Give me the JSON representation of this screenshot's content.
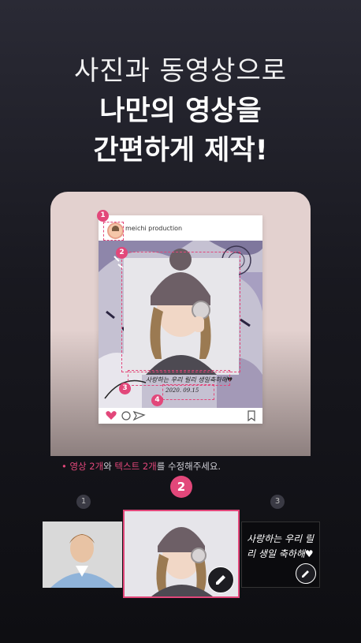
{
  "headline": {
    "line1": "사진과 동영상으로",
    "line2": "나만의 영상을",
    "line3": "간편하게 제작!"
  },
  "preview": {
    "profile_name": "meichi production",
    "caption": "사랑하는 우리 릴리 생일축하해♥",
    "date": "2020. 09.15",
    "markers": [
      "1",
      "2",
      "3",
      "4"
    ]
  },
  "hint": {
    "bullet": "•",
    "video_count": "영상 2개",
    "and": "와",
    "text_count": "텍스트 2개",
    "suffix": "를 수정해주세요."
  },
  "steps": {
    "step1": "1",
    "step2": "2",
    "step3": "3"
  },
  "thumbnails": {
    "text_clip": "사랑하는 우리 릴리 생일 축하해♥"
  },
  "colors": {
    "accent": "#e2477a",
    "panel": "#e3d1cf",
    "background": "#18181f"
  },
  "icons": [
    "pencil-icon",
    "heart-icon",
    "comment-icon",
    "share-icon",
    "bookmark-icon"
  ]
}
